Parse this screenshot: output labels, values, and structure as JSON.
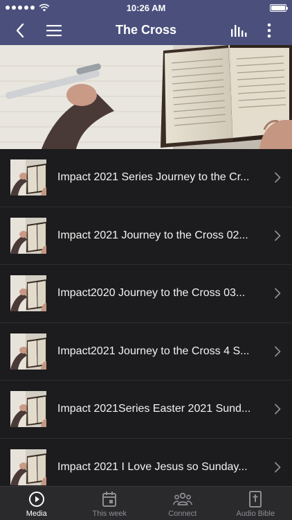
{
  "status_bar": {
    "time": "10:26 AM"
  },
  "nav": {
    "title": "The Cross",
    "back_icon": "chevron-left-icon",
    "menu_icon": "hamburger-menu-icon",
    "equalizer_icon": "equalizer-icon",
    "more_icon": "more-vertical-icon"
  },
  "hero": {
    "image": "notebook-and-open-bible-photo"
  },
  "items": [
    {
      "title": "Impact 2021 Series Journey to the Cr..."
    },
    {
      "title": "Impact 2021 Journey to the Cross 02..."
    },
    {
      "title": "Impact2020 Journey to the Cross 03..."
    },
    {
      "title": "Impact2021 Journey to the Cross 4 S..."
    },
    {
      "title": "Impact 2021Series Easter 2021 Sund..."
    },
    {
      "title": "Impact 2021 I Love Jesus so Sunday..."
    }
  ],
  "tabs": [
    {
      "label": "Media",
      "icon": "play-circle-icon",
      "active": true
    },
    {
      "label": "This week",
      "icon": "calendar-icon",
      "active": false
    },
    {
      "label": "Connect",
      "icon": "people-group-icon",
      "active": false
    },
    {
      "label": "Audio Bible",
      "icon": "bible-icon",
      "active": false
    }
  ],
  "colors": {
    "header": "#4a4f7c",
    "list_bg": "#1c1c1e",
    "tab_bar": "#2a2a2d",
    "inactive": "#8e8e93"
  }
}
